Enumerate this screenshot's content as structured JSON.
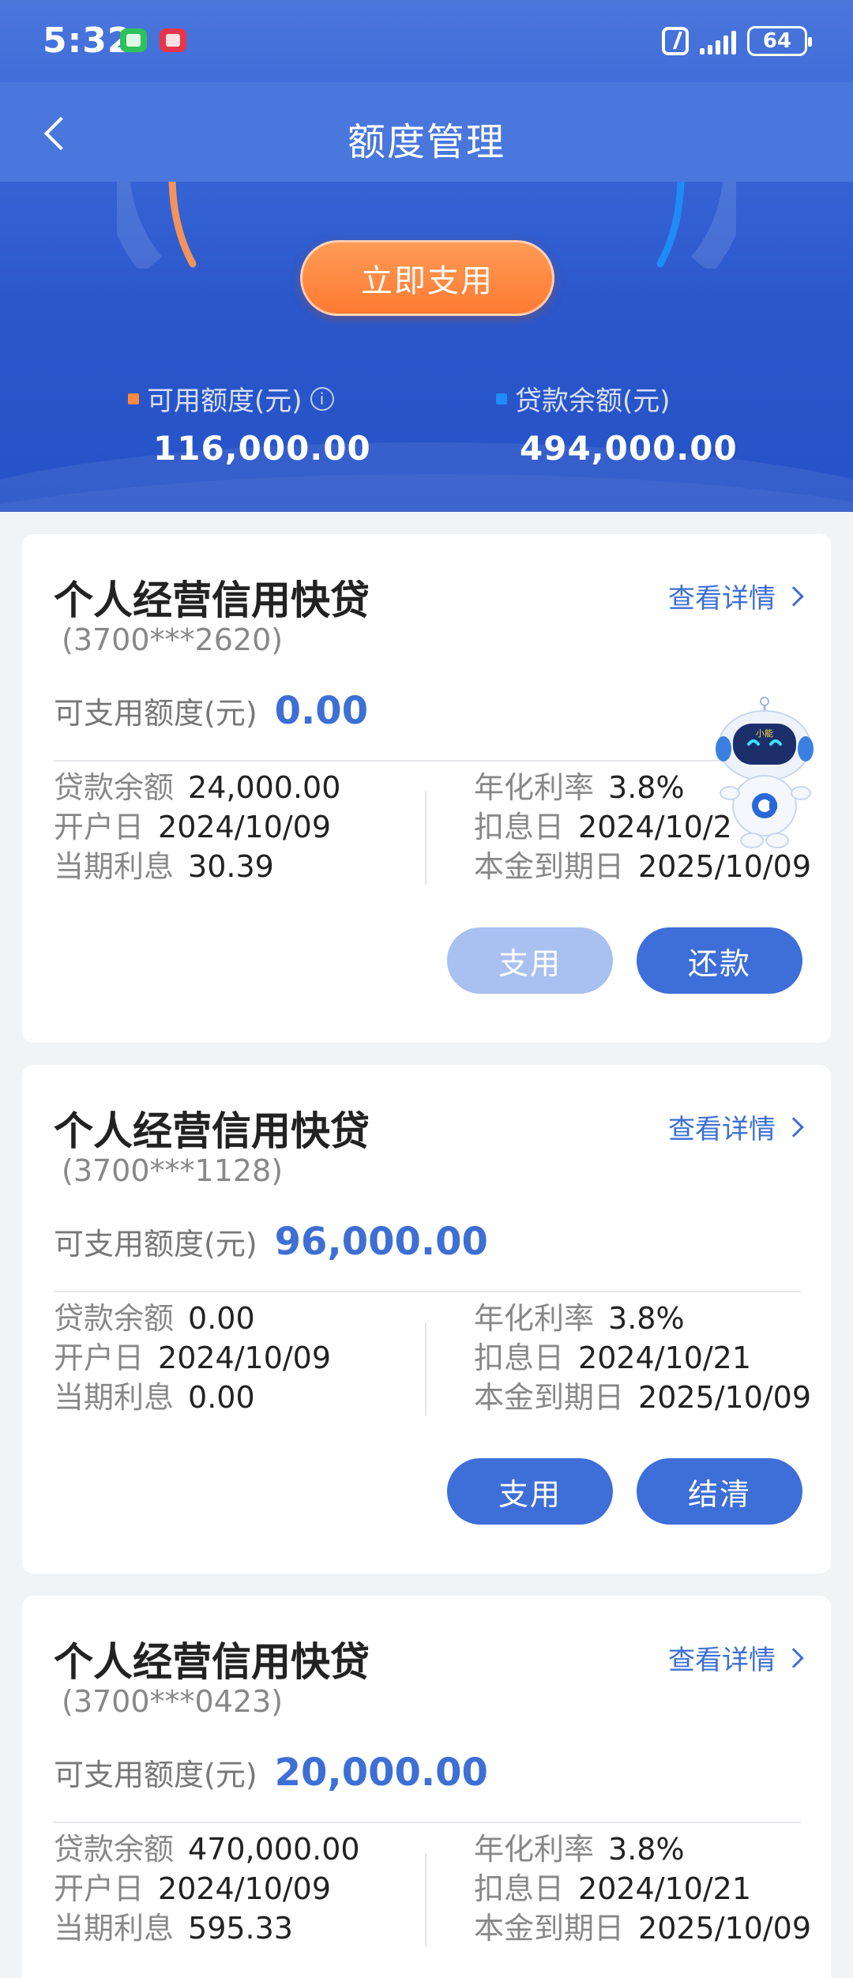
{
  "status_bar": {
    "time": "5:32",
    "battery": "64"
  },
  "nav": {
    "title": "额度管理"
  },
  "hero": {
    "use_now_label": "立即支用",
    "available": {
      "label": "可用额度(元)",
      "value": "116,000.00"
    },
    "loan_balance": {
      "label": "贷款余额(元)",
      "value": "494,000.00"
    },
    "info_symbol": "i"
  },
  "cards": [
    {
      "title": "个人经营信用快贷",
      "account": "(3700***2620)",
      "detail_label": "查看详情",
      "avail_label": "可支用额度(元)",
      "avail_value": "0.00",
      "left": [
        {
          "k": "贷款余额",
          "v": "24,000.00"
        },
        {
          "k": "开户日",
          "v": "2024/10/09"
        },
        {
          "k": "当期利息",
          "v": "30.39"
        }
      ],
      "right": [
        {
          "k": "年化利率",
          "v": "3.8%"
        },
        {
          "k": "扣息日",
          "v": "2024/10/2"
        },
        {
          "k": "本金到期日",
          "v": "2025/10/09"
        }
      ],
      "btn_left": "支用",
      "btn_right": "还款"
    },
    {
      "title": "个人经营信用快贷",
      "account": "(3700***1128)",
      "detail_label": "查看详情",
      "avail_label": "可支用额度(元)",
      "avail_value": "96,000.00",
      "left": [
        {
          "k": "贷款余额",
          "v": "0.00"
        },
        {
          "k": "开户日",
          "v": "2024/10/09"
        },
        {
          "k": "当期利息",
          "v": "0.00"
        }
      ],
      "right": [
        {
          "k": "年化利率",
          "v": "3.8%"
        },
        {
          "k": "扣息日",
          "v": "2024/10/21"
        },
        {
          "k": "本金到期日",
          "v": "2025/10/09"
        }
      ],
      "btn_left": "支用",
      "btn_right": "结清"
    },
    {
      "title": "个人经营信用快贷",
      "account": "(3700***0423)",
      "detail_label": "查看详情",
      "avail_label": "可支用额度(元)",
      "avail_value": "20,000.00",
      "left": [
        {
          "k": "贷款余额",
          "v": "470,000.00"
        },
        {
          "k": "开户日",
          "v": "2024/10/09"
        },
        {
          "k": "当期利息",
          "v": "595.33"
        }
      ],
      "right": [
        {
          "k": "年化利率",
          "v": "3.8%"
        },
        {
          "k": "扣息日",
          "v": "2024/10/21"
        },
        {
          "k": "本金到期日",
          "v": "2025/10/09"
        }
      ]
    }
  ],
  "mascot": {
    "badge": "小能"
  },
  "colors": {
    "brand_blue": "#3e6ed7",
    "accent_orange": "#ff8a3d",
    "link_blue": "#3d6fd4"
  }
}
